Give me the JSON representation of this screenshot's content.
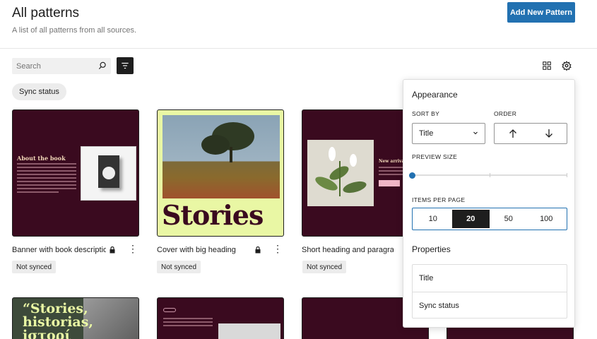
{
  "header": {
    "title": "All patterns",
    "subtitle": "A list of all patterns from all sources.",
    "add_button": "Add New Pattern"
  },
  "toolbar": {
    "search_placeholder": "Search",
    "filter_chip": "Sync status"
  },
  "cards": [
    {
      "title": "Banner with book descriptio",
      "status": "Not synced",
      "preview_heading": "About the book"
    },
    {
      "title": "Cover with big heading",
      "status": "Not synced",
      "preview_heading": "Stories"
    },
    {
      "title": "Short heading and paragrap",
      "status": "Not synced",
      "preview_heading": "New arrivals"
    }
  ],
  "bottom_cards": [
    {
      "preview_heading": "“Stories, historias, iστορί"
    }
  ],
  "view_options": {
    "appearance_heading": "Appearance",
    "sort_by_label": "SORT BY",
    "sort_by_value": "Title",
    "order_label": "ORDER",
    "preview_size_label": "PREVIEW SIZE",
    "items_per_page_label": "ITEMS PER PAGE",
    "items_per_page_options": [
      "10",
      "20",
      "50",
      "100"
    ],
    "items_per_page_selected": "20",
    "properties_heading": "Properties",
    "properties": [
      "Title",
      "Sync status"
    ]
  },
  "colors": {
    "accent": "#2271b1",
    "card_maroon": "#3a0a1f",
    "cover_yellow": "#e9f7a4"
  }
}
